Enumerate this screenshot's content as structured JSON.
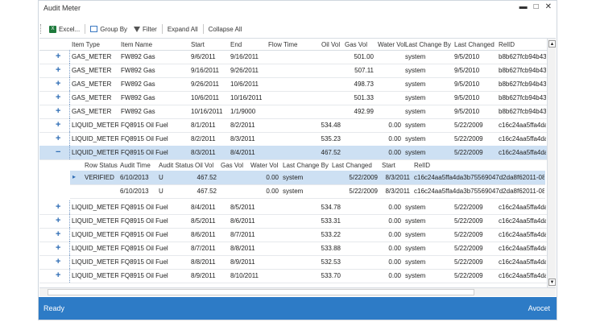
{
  "window": {
    "title": "Audit Meter",
    "minimize": "▬",
    "maximize": "□",
    "close": "✕"
  },
  "toolbar": {
    "excel": "Excel...",
    "group_by": "Group By",
    "filter": "Filter",
    "expand_all": "Expand All",
    "collapse_all": "Collapse All"
  },
  "columns": [
    "Item Type",
    "Item Name",
    "Start",
    "End",
    "Flow Time",
    "Oil Vol",
    "Gas Vol",
    "Water Vol",
    "Last Change By",
    "Last Changed",
    "RelID"
  ],
  "rows_top": [
    {
      "exp": "+",
      "type": "GAS_METER",
      "name": "FW892 Gas",
      "start": "9/6/2011",
      "end": "9/16/2011",
      "flow": "",
      "oil": "",
      "gas": "501.00",
      "water": "",
      "by": "system",
      "changed": "9/5/2010",
      "relid": "b8b627fcb94b43"
    },
    {
      "exp": "+",
      "type": "GAS_METER",
      "name": "FW892 Gas",
      "start": "9/16/2011",
      "end": "9/26/2011",
      "flow": "",
      "oil": "",
      "gas": "507.11",
      "water": "",
      "by": "system",
      "changed": "9/5/2010",
      "relid": "b8b627fcb94b43"
    },
    {
      "exp": "+",
      "type": "GAS_METER",
      "name": "FW892 Gas",
      "start": "9/26/2011",
      "end": "10/6/2011",
      "flow": "",
      "oil": "",
      "gas": "498.73",
      "water": "",
      "by": "system",
      "changed": "9/5/2010",
      "relid": "b8b627fcb94b43"
    },
    {
      "exp": "+",
      "type": "GAS_METER",
      "name": "FW892 Gas",
      "start": "10/6/2011",
      "end": "10/16/2011",
      "flow": "",
      "oil": "",
      "gas": "501.33",
      "water": "",
      "by": "system",
      "changed": "9/5/2010",
      "relid": "b8b627fcb94b43"
    },
    {
      "exp": "+",
      "type": "GAS_METER",
      "name": "FW892 Gas",
      "start": "10/16/2011",
      "end": "1/1/9000",
      "flow": "",
      "oil": "",
      "gas": "492.99",
      "water": "",
      "by": "system",
      "changed": "9/5/2010",
      "relid": "b8b627fcb94b43"
    },
    {
      "exp": "+",
      "type": "LIQUID_METER",
      "name": "FQ8915 Oil Fuel",
      "start": "8/1/2011",
      "end": "8/2/2011",
      "flow": "",
      "oil": "534.48",
      "gas": "",
      "water": "0.00",
      "by": "system",
      "changed": "5/22/2009",
      "relid": "c16c24aa5ffa4da"
    },
    {
      "exp": "+",
      "type": "LIQUID_METER",
      "name": "FQ8915 Oil Fuel",
      "start": "8/2/2011",
      "end": "8/3/2011",
      "flow": "",
      "oil": "535.23",
      "gas": "",
      "water": "0.00",
      "by": "system",
      "changed": "5/22/2009",
      "relid": "c16c24aa5ffa4da"
    },
    {
      "exp": "−",
      "type": "LIQUID_METER",
      "name": "FQ8915 Oil Fuel",
      "start": "8/3/2011",
      "end": "8/4/2011",
      "flow": "",
      "oil": "467.52",
      "gas": "",
      "water": "0.00",
      "by": "system",
      "changed": "5/22/2009",
      "relid": "c16c24aa5ffa4da"
    }
  ],
  "sub_columns": [
    "Row Status",
    "Audit Time",
    "Audit Status",
    "Oil Vol",
    "Gas Vol",
    "Water Vol",
    "Last Change By",
    "Last Changed",
    "Start",
    "RelID"
  ],
  "sub_rows": [
    {
      "arrow": "▸",
      "status": "VERIFIED",
      "time": "6/10/2013",
      "astatus": "U",
      "oil": "467.52",
      "gas": "",
      "water": "0.00",
      "by": "system",
      "changed": "5/22/2009",
      "start": "8/3/2011",
      "relid": "c16c24aa5ffa4da3b75569047d2da8f62011-08-03"
    },
    {
      "arrow": "",
      "status": "",
      "time": "6/10/2013",
      "astatus": "U",
      "oil": "467.52",
      "gas": "",
      "water": "0.00",
      "by": "system",
      "changed": "5/22/2009",
      "start": "8/3/2011",
      "relid": "c16c24aa5ffa4da3b75569047d2da8f62011-08-03"
    }
  ],
  "rows_bottom": [
    {
      "exp": "+",
      "type": "LIQUID_METER",
      "name": "FQ8915 Oil Fuel",
      "start": "8/4/2011",
      "end": "8/5/2011",
      "flow": "",
      "oil": "534.78",
      "gas": "",
      "water": "0.00",
      "by": "system",
      "changed": "5/22/2009",
      "relid": "c16c24aa5ffa4da"
    },
    {
      "exp": "+",
      "type": "LIQUID_METER",
      "name": "FQ8915 Oil Fuel",
      "start": "8/5/2011",
      "end": "8/6/2011",
      "flow": "",
      "oil": "533.31",
      "gas": "",
      "water": "0.00",
      "by": "system",
      "changed": "5/22/2009",
      "relid": "c16c24aa5ffa4da"
    },
    {
      "exp": "+",
      "type": "LIQUID_METER",
      "name": "FQ8915 Oil Fuel",
      "start": "8/6/2011",
      "end": "8/7/2011",
      "flow": "",
      "oil": "533.22",
      "gas": "",
      "water": "0.00",
      "by": "system",
      "changed": "5/22/2009",
      "relid": "c16c24aa5ffa4da"
    },
    {
      "exp": "+",
      "type": "LIQUID_METER",
      "name": "FQ8915 Oil Fuel",
      "start": "8/7/2011",
      "end": "8/8/2011",
      "flow": "",
      "oil": "533.88",
      "gas": "",
      "water": "0.00",
      "by": "system",
      "changed": "5/22/2009",
      "relid": "c16c24aa5ffa4da"
    },
    {
      "exp": "+",
      "type": "LIQUID_METER",
      "name": "FQ8915 Oil Fuel",
      "start": "8/8/2011",
      "end": "8/9/2011",
      "flow": "",
      "oil": "532.53",
      "gas": "",
      "water": "0.00",
      "by": "system",
      "changed": "5/22/2009",
      "relid": "c16c24aa5ffa4da"
    },
    {
      "exp": "+",
      "type": "LIQUID_METER",
      "name": "FQ8915 Oil Fuel",
      "start": "8/9/2011",
      "end": "8/10/2011",
      "flow": "",
      "oil": "533.70",
      "gas": "",
      "water": "0.00",
      "by": "system",
      "changed": "5/22/2009",
      "relid": "c16c24aa5ffa4da"
    }
  ],
  "status": {
    "left": "Ready",
    "right": "Avocet"
  },
  "colors": {
    "status_bar": "#2d7bc6",
    "selected_row": "#cde0f3",
    "expander": "#2f6db5"
  }
}
